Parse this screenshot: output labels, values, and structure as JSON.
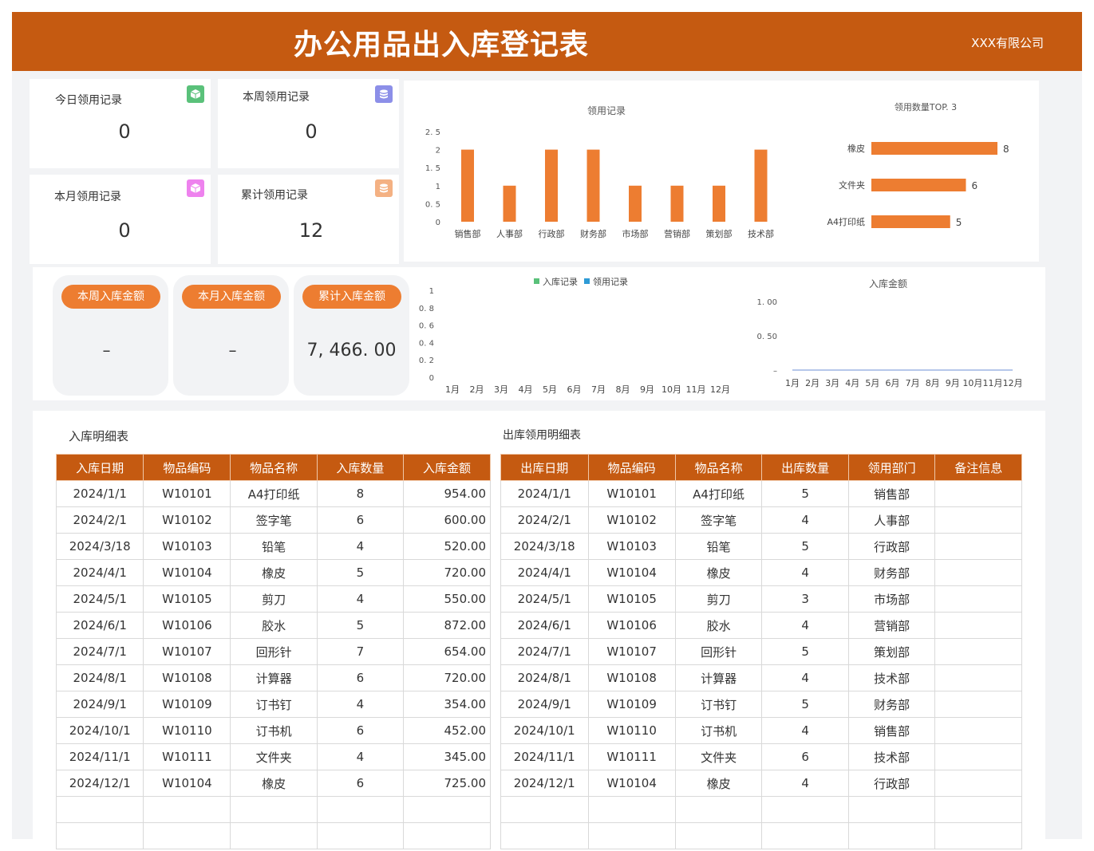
{
  "header": {
    "title": "办公用品出入库登记表",
    "company": "XXX有限公司"
  },
  "stats": [
    {
      "label": "今日领用记录",
      "value": "0",
      "icon": "cube-icon",
      "color": "#5ac17a"
    },
    {
      "label": "本周领用记录",
      "value": "0",
      "icon": "database-icon",
      "color": "#8c8fe8"
    },
    {
      "label": "本月领用记录",
      "value": "0",
      "icon": "cube-icon",
      "color": "#ee82ee"
    },
    {
      "label": "累计领用记录",
      "value": "12",
      "icon": "database-icon",
      "color": "#f4b183"
    }
  ],
  "amounts": [
    {
      "label": "本周入库金额",
      "value": "–"
    },
    {
      "label": "本月入库金额",
      "value": "–"
    },
    {
      "label": "累计入库金额",
      "value": "7, 466. 00"
    }
  ],
  "colors": {
    "brand": "#c55a11",
    "accent": "#ed7d31",
    "series_in": "#5ac17a",
    "series_out": "#2e9bd6"
  },
  "chart_data": [
    {
      "type": "bar",
      "title": "领用记录",
      "categories": [
        "销售部",
        "人事部",
        "行政部",
        "财务部",
        "市场部",
        "营销部",
        "策划部",
        "技术部"
      ],
      "values": [
        2,
        1,
        2,
        2,
        1,
        1,
        1,
        2
      ],
      "yticks": [
        "0",
        "0. 5",
        "1",
        "1. 5",
        "2",
        "2. 5"
      ],
      "ylim": [
        0,
        2.5
      ]
    },
    {
      "type": "bar",
      "orientation": "horizontal",
      "title": "领用数量TOP. 3",
      "categories": [
        "橡皮",
        "文件夹",
        "A4打印纸"
      ],
      "values": [
        8,
        6,
        5
      ]
    },
    {
      "type": "line",
      "categories": [
        "1月",
        "2月",
        "3月",
        "4月",
        "5月",
        "6月",
        "7月",
        "8月",
        "9月",
        "10月",
        "11月",
        "12月"
      ],
      "series": [
        {
          "name": "入库记录",
          "values": []
        },
        {
          "name": "领用记录",
          "values": []
        }
      ],
      "yticks": [
        "0",
        "0. 2",
        "0. 4",
        "0. 6",
        "0. 8",
        "1"
      ],
      "ylim": [
        0,
        1
      ],
      "legend": "top"
    },
    {
      "type": "line",
      "title": "入库金额",
      "categories": [
        "1月",
        "2月",
        "3月",
        "4月",
        "5月",
        "6月",
        "7月",
        "8月",
        "9月",
        "10月",
        "11月",
        "12月"
      ],
      "values": [
        0,
        0,
        0,
        0,
        0,
        0,
        0,
        0,
        0,
        0,
        0,
        0
      ],
      "yticks": [
        "–",
        "0. 50",
        "1. 00"
      ],
      "ylim": [
        0,
        1
      ]
    }
  ],
  "inbound": {
    "title": "入库明细表",
    "headers": [
      "入库日期",
      "物品编码",
      "物品名称",
      "入库数量",
      "入库金额"
    ],
    "rows": [
      [
        "2024/1/1",
        "W10101",
        "A4打印纸",
        "8",
        "954.00"
      ],
      [
        "2024/2/1",
        "W10102",
        "签字笔",
        "6",
        "600.00"
      ],
      [
        "2024/3/18",
        "W10103",
        "铅笔",
        "4",
        "520.00"
      ],
      [
        "2024/4/1",
        "W10104",
        "橡皮",
        "5",
        "720.00"
      ],
      [
        "2024/5/1",
        "W10105",
        "剪刀",
        "4",
        "550.00"
      ],
      [
        "2024/6/1",
        "W10106",
        "胶水",
        "5",
        "872.00"
      ],
      [
        "2024/7/1",
        "W10107",
        "回形针",
        "7",
        "654.00"
      ],
      [
        "2024/8/1",
        "W10108",
        "计算器",
        "6",
        "720.00"
      ],
      [
        "2024/9/1",
        "W10109",
        "订书钉",
        "4",
        "354.00"
      ],
      [
        "2024/10/1",
        "W10110",
        "订书机",
        "6",
        "452.00"
      ],
      [
        "2024/11/1",
        "W10111",
        "文件夹",
        "4",
        "345.00"
      ],
      [
        "2024/12/1",
        "W10104",
        "橡皮",
        "6",
        "725.00"
      ],
      [
        "",
        "",
        "",
        "",
        ""
      ],
      [
        "",
        "",
        "",
        "",
        ""
      ]
    ]
  },
  "outbound": {
    "title": "出库领用明细表",
    "headers": [
      "出库日期",
      "物品编码",
      "物品名称",
      "出库数量",
      "领用部门",
      "备注信息"
    ],
    "rows": [
      [
        "2024/1/1",
        "W10101",
        "A4打印纸",
        "5",
        "销售部",
        ""
      ],
      [
        "2024/2/1",
        "W10102",
        "签字笔",
        "4",
        "人事部",
        ""
      ],
      [
        "2024/3/18",
        "W10103",
        "铅笔",
        "5",
        "行政部",
        ""
      ],
      [
        "2024/4/1",
        "W10104",
        "橡皮",
        "4",
        "财务部",
        ""
      ],
      [
        "2024/5/1",
        "W10105",
        "剪刀",
        "3",
        "市场部",
        ""
      ],
      [
        "2024/6/1",
        "W10106",
        "胶水",
        "4",
        "营销部",
        ""
      ],
      [
        "2024/7/1",
        "W10107",
        "回形针",
        "5",
        "策划部",
        ""
      ],
      [
        "2024/8/1",
        "W10108",
        "计算器",
        "4",
        "技术部",
        ""
      ],
      [
        "2024/9/1",
        "W10109",
        "订书钉",
        "5",
        "财务部",
        ""
      ],
      [
        "2024/10/1",
        "W10110",
        "订书机",
        "4",
        "销售部",
        ""
      ],
      [
        "2024/11/1",
        "W10111",
        "文件夹",
        "6",
        "技术部",
        ""
      ],
      [
        "2024/12/1",
        "W10104",
        "橡皮",
        "4",
        "行政部",
        ""
      ],
      [
        "",
        "",
        "",
        "",
        "",
        ""
      ],
      [
        "",
        "",
        "",
        "",
        "",
        ""
      ]
    ]
  }
}
